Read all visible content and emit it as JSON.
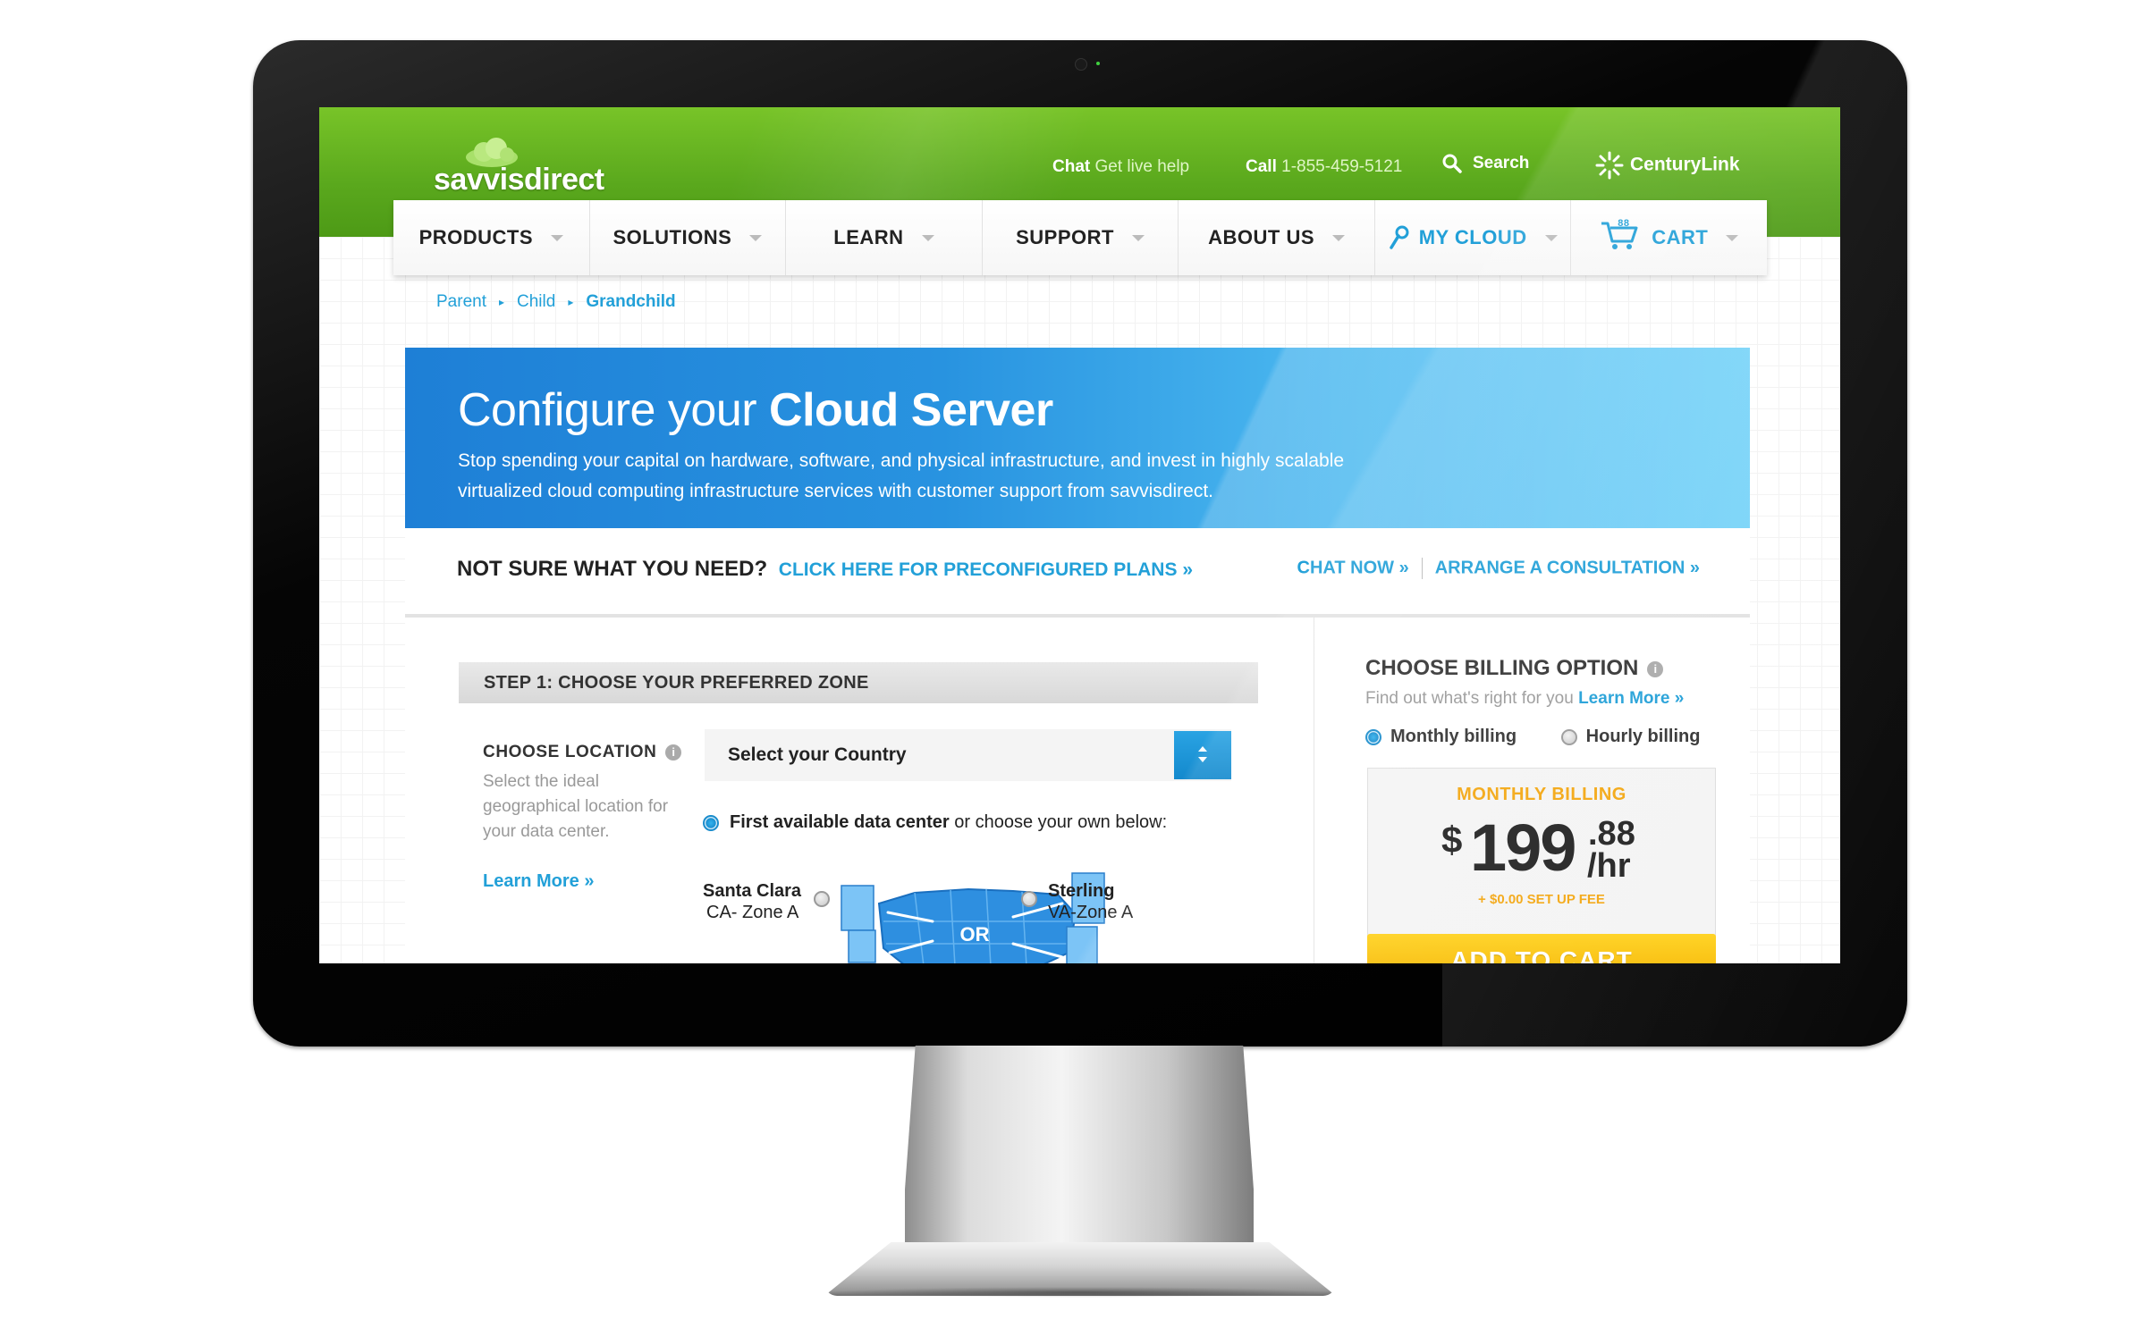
{
  "header": {
    "logo": "savvisdirect",
    "chat_label": "Chat",
    "chat_sub": "Get live help",
    "call_label": "Call",
    "call_number": "1-855-459-5121",
    "search_label": "Search",
    "partner": "CenturyLink"
  },
  "nav": {
    "items": [
      "PRODUCTS",
      "SOLUTIONS",
      "LEARN",
      "SUPPORT",
      "ABOUT US",
      "MY CLOUD",
      "CART"
    ],
    "cart_count": "88"
  },
  "breadcrumb": [
    "Parent",
    "Child",
    "Grandchild"
  ],
  "hero": {
    "title_light": "Configure your",
    "title_bold": "Cloud Server",
    "description": "Stop spending your capital on hardware, software, and physical infrastructure, and invest in highly scalable virtualized cloud computing infrastructure services with customer support from savvisdirect."
  },
  "helpbar": {
    "question": "NOT SURE WHAT YOU NEED?",
    "plans_link": "CLICK HERE FOR PRECONFIGURED PLANS »",
    "chat_link": "CHAT NOW »",
    "consult_link": "ARRANGE A CONSULTATION »"
  },
  "step1": {
    "title": "STEP 1: CHOOSE YOUR PREFERRED ZONE",
    "location_label": "CHOOSE LOCATION",
    "location_desc": "Select the ideal geographical location for your data center.",
    "learn_more": "Learn More »",
    "country_select": "Select your Country",
    "first_available_bold": "First available data center",
    "first_available_rest": "or choose your own below:",
    "left_dc_name": "Santa Clara",
    "left_dc_zone": "CA- Zone A",
    "right_dc_name": "Sterling",
    "right_dc_zone": "VA-Zone A",
    "map_or": "OR"
  },
  "billing": {
    "title": "CHOOSE BILLING OPTION",
    "subtitle": "Find out what's right for you",
    "learn_more": "Learn More »",
    "options": [
      "Monthly billing",
      "Hourly billing"
    ],
    "selected": "Monthly billing",
    "box_label": "MONTHLY BILLING",
    "currency": "$",
    "price_int": "199",
    "price_cents": ".88",
    "price_unit": "/hr",
    "setup_fee": "+ $0.00 SET UP FEE",
    "add_to_cart": "ADD TO CART"
  },
  "colors": {
    "brand_green": "#5aa81d",
    "accent_blue": "#22a0d8",
    "price_orange": "#f3a712",
    "cta_yellow": "#f6b400"
  }
}
